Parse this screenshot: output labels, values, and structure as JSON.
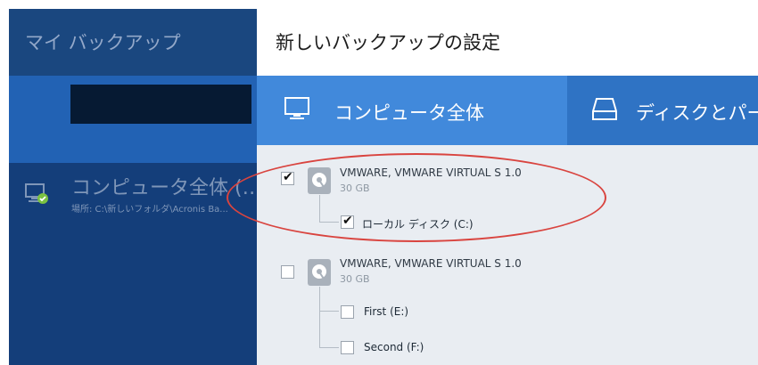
{
  "sidebar": {
    "title": "マイ バックアップ",
    "items": [
      {
        "name": "コンピュータ全体 (…",
        "path": "場所: C:\\新しいフォルダ\\Acronis Ba..."
      }
    ]
  },
  "main": {
    "title": "新しいバックアップの設定",
    "tabs": [
      {
        "label": "コンピュータ全体",
        "icon": "monitor-icon"
      },
      {
        "label": "ディスクとパー",
        "icon": "drive-icon"
      }
    ],
    "disks": [
      {
        "name": "VMWARE, VMWARE VIRTUAL S 1.0",
        "size": "30 GB",
        "checked": true,
        "partitions": [
          {
            "label": "ローカル ディスク (C:)",
            "checked": true
          }
        ]
      },
      {
        "name": "VMWARE, VMWARE VIRTUAL S 1.0",
        "size": "30 GB",
        "checked": false,
        "partitions": [
          {
            "label": "First (E:)",
            "checked": false
          },
          {
            "label": "Second (F:)",
            "checked": false
          }
        ]
      }
    ]
  },
  "colors": {
    "sidebar_bg": "#143e7a",
    "sidebar_selected": "#2262b4",
    "tab_active": "#4189db",
    "tab_bar": "#2f73c4",
    "annotation": "#d9443f",
    "status_ok": "#7ac142"
  }
}
